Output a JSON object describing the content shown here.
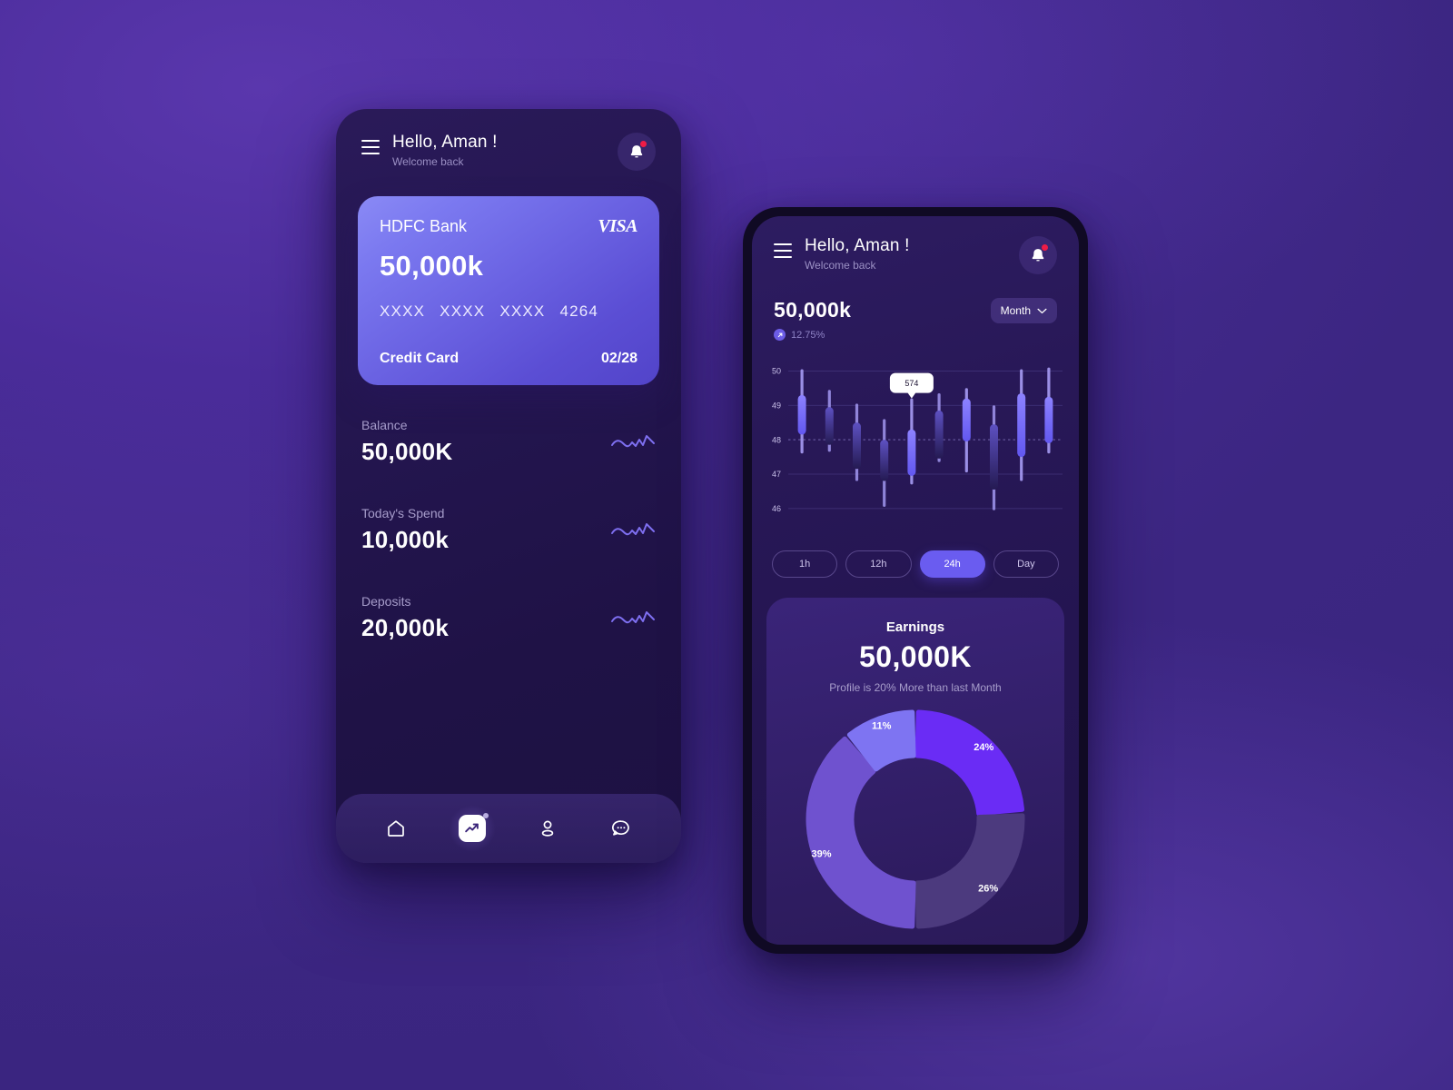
{
  "background": {
    "accent": "#6a5cf0",
    "deep": "#22144c",
    "page": "#472b94"
  },
  "phone_one": {
    "header": {
      "menu_icon": "hamburger-menu-icon",
      "greeting": "Hello, Aman !",
      "subtitle": "Welcome back",
      "bell_icon": "bell-icon",
      "has_notification": true
    },
    "card": {
      "bank": "HDFC Bank",
      "brand": "VISA",
      "amount": "50,000k",
      "number_groups": [
        "XXXX",
        "XXXX",
        "XXXX",
        "4264"
      ],
      "type": "Credit Card",
      "expiry": "02/28"
    },
    "stats": [
      {
        "label": "Balance",
        "value": "50,000K",
        "spark": "sparkline-icon"
      },
      {
        "label": "Today's Spend",
        "value": "10,000k",
        "spark": "sparkline-icon"
      },
      {
        "label": "Deposits",
        "value": "20,000k",
        "spark": "sparkline-icon"
      }
    ],
    "nav": [
      {
        "name": "home",
        "icon": "home-icon",
        "active": false
      },
      {
        "name": "analytics",
        "icon": "chart-trend-icon",
        "active": true
      },
      {
        "name": "profile",
        "icon": "user-icon",
        "active": false
      },
      {
        "name": "messages",
        "icon": "chat-bubble-icon",
        "active": false
      }
    ]
  },
  "phone_two": {
    "header": {
      "menu_icon": "hamburger-menu-icon",
      "greeting": "Hello, Aman !",
      "subtitle": "Welcome back",
      "bell_icon": "bell-icon",
      "has_notification": true
    },
    "summary": {
      "amount": "50,000k",
      "delta": "12.75%",
      "delta_icon": "trend-up-arrow-icon",
      "range_label": "Month",
      "range_caret": "chevron-down-icon",
      "range_options": [
        "Month"
      ]
    },
    "timeframes": [
      {
        "label": "1h",
        "active": false
      },
      {
        "label": "12h",
        "active": false
      },
      {
        "label": "24h",
        "active": true
      },
      {
        "label": "Day",
        "active": false
      }
    ],
    "earnings": {
      "title": "Earnings",
      "amount": "50,000K",
      "note": "Profile is 20% More than last Month"
    }
  },
  "chart_data": [
    {
      "type": "candlestick",
      "title": "",
      "xlabel": "",
      "ylabel": "",
      "ylim": [
        45.6,
        50.3
      ],
      "yticks": [
        50,
        49,
        48,
        47,
        46
      ],
      "grid": true,
      "dashed_gridline_at": 48,
      "tooltip": {
        "label": "574",
        "candle_index": 4
      },
      "candles": [
        {
          "open": 48.15,
          "close": 49.3,
          "low": 47.6,
          "high": 50.05,
          "dir": "up"
        },
        {
          "open": 47.85,
          "close": 48.95,
          "low": 47.65,
          "high": 49.45,
          "dir": "down"
        },
        {
          "open": 47.15,
          "close": 48.5,
          "low": 46.8,
          "high": 49.05,
          "dir": "down"
        },
        {
          "open": 46.8,
          "close": 48.0,
          "low": 46.05,
          "high": 48.6,
          "dir": "down"
        },
        {
          "open": 46.95,
          "close": 48.3,
          "low": 46.7,
          "high": 49.2,
          "dir": "up"
        },
        {
          "open": 47.45,
          "close": 48.85,
          "low": 47.35,
          "high": 49.35,
          "dir": "down"
        },
        {
          "open": 47.95,
          "close": 49.2,
          "low": 47.05,
          "high": 49.5,
          "dir": "up"
        },
        {
          "open": 46.55,
          "close": 48.45,
          "low": 45.95,
          "high": 49.0,
          "dir": "down"
        },
        {
          "open": 47.5,
          "close": 49.35,
          "low": 46.8,
          "high": 50.05,
          "dir": "up"
        },
        {
          "open": 47.9,
          "close": 49.25,
          "low": 47.6,
          "high": 50.1,
          "dir": "up"
        }
      ]
    },
    {
      "type": "pie",
      "title": "Earnings",
      "subtitle": "Profile is 20% More than last Month",
      "legend": "none",
      "labels": [
        "24%",
        "26%",
        "39%",
        "11%"
      ],
      "values": [
        24,
        26,
        39,
        11
      ],
      "colors": [
        "#6a2cf5",
        "#4c3a7e",
        "#6f52cf",
        "#7e74f2"
      ],
      "donut": true
    }
  ]
}
